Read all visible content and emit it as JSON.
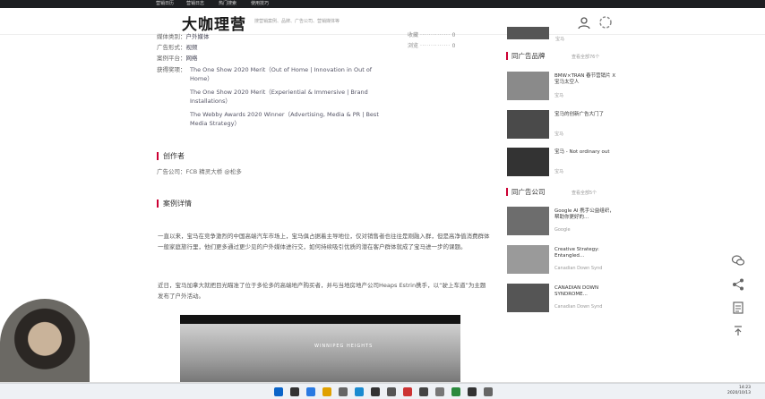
{
  "topnav": {
    "items": [
      "营销日历",
      "营销日志",
      "热门搜索",
      "使用技巧"
    ]
  },
  "header": {
    "logo": "大咖理营",
    "search_placeholder": "搜营销案例、品牌、广告公司、营销媒体等"
  },
  "meta": {
    "rows": [
      {
        "key": "媒体类别",
        "value": "户外媒体"
      },
      {
        "key": "广告形式",
        "value": "视频"
      },
      {
        "key": "案例平台",
        "value": "网络"
      }
    ],
    "awards_key": "获得奖项",
    "awards": [
      "The One Show 2020 Merit（Out of Home | Innovation in Out of Home）",
      "The One Show 2020 Merit（Experiential & Immersive | Brand Installations）",
      "The Webby Awards 2020 Winner（Advertising, Media & PR | Best Media Strategy）"
    ]
  },
  "stats": [
    {
      "label": "收藏",
      "value": "0"
    },
    {
      "label": "浏览",
      "value": "0"
    }
  ],
  "creators": {
    "heading": "创作者",
    "agency_label": "广告公司：",
    "agency_value": "FCB 精灵大桥 @松多"
  },
  "case": {
    "heading": "案例详情",
    "para1": "一直以来，宝马在竞争激烈的中国高端汽车市场上，宝马俱占据着主导地位，仅对销售者也往往是刚融入群，但是高净值消费群体一般家庭旅行里，他们更多通过更少见的户外媒体进行交，如何持续吸引优质的潜在客户群体就成了宝马进一步的课题。",
    "para2": "近日，宝马加拿大就把目光瞄准了位于多伦多的高端地产购买者，并与当地房地产公司Heaps Estrin携手，以“驶上车道”为主题发布了户外活动。",
    "video_caption": "WINNIPEG HEIGHTS"
  },
  "sidebar": {
    "top_sub": "宝马",
    "brand_heading": "同广告品牌",
    "brand_more": "查看全部76个",
    "brand_items": [
      {
        "title": "BMW×TRAN 春节营销片 X宝马太空人",
        "sub": "宝马"
      },
      {
        "title": "宝马的创新广告大门了",
        "sub": "宝马"
      },
      {
        "title": "宝马 - Not ordinary out",
        "sub": "宝马"
      }
    ],
    "agency_heading": "同广告公司",
    "agency_more": "查看全部5个",
    "agency_items": [
      {
        "title": "Google AI 携手公益组织，帮助你更好的...",
        "sub": "Google"
      },
      {
        "title": "Creative Strategy: Entangled...",
        "sub": "Canadian Down Synd"
      },
      {
        "title": "CANADIAN DOWN SYNDROME...",
        "sub": "Canadian Down Synd"
      }
    ]
  },
  "taskbar": {
    "time": "14:23",
    "date": "2020/10/13"
  }
}
